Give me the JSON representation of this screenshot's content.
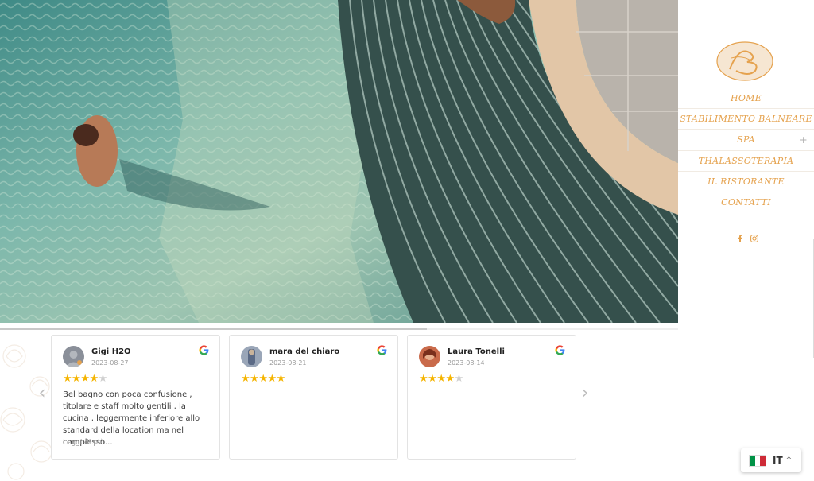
{
  "nav": {
    "items": [
      {
        "label": "HOME"
      },
      {
        "label": "STABILIMENTO BALNEARE"
      },
      {
        "label": "SPA",
        "expand": "+"
      },
      {
        "label": "THALASSOTERAPIA"
      },
      {
        "label": "IL RISTORANTE"
      },
      {
        "label": "CONTATTI"
      }
    ],
    "social_icons": [
      "facebook-icon",
      "instagram-icon"
    ],
    "accent_color": "#e5a24e"
  },
  "reviews": {
    "prev_arrow": "‹",
    "next_arrow": "›",
    "cards": [
      {
        "name": "Gigi H2O",
        "date": "2023-08-27",
        "rating": 4,
        "text": "Bel bagno con poca confusione , titolare e staff molto gentili , la cucina , leggermente inferiore allo standard della location ma nel complesso...",
        "more": "Leggi di più"
      },
      {
        "name": "mara del chiaro",
        "date": "2023-08-21",
        "rating": 5,
        "text": "",
        "more": ""
      },
      {
        "name": "Laura Tonelli",
        "date": "2023-08-14",
        "rating": 4,
        "text": "",
        "more": ""
      }
    ],
    "star_color": "#f5b400"
  },
  "language": {
    "code": "IT",
    "chevron": "^"
  }
}
